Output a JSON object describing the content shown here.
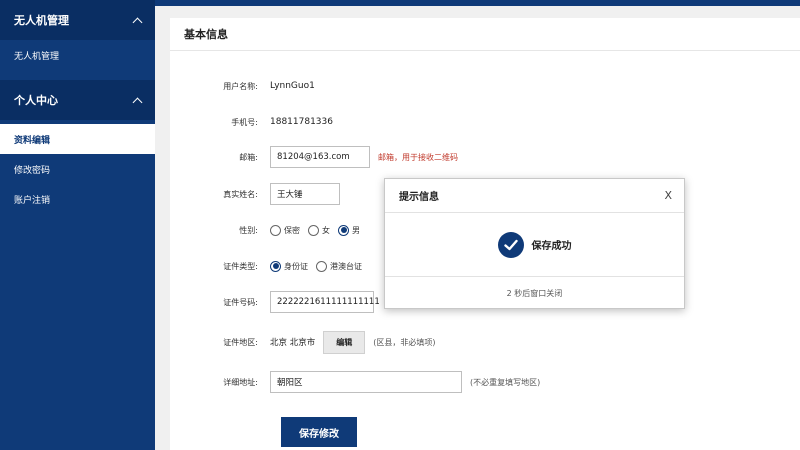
{
  "sidebar": {
    "groups": [
      {
        "title": "无人机管理",
        "items": [
          "无人机管理"
        ]
      },
      {
        "title": "个人中心",
        "items": [
          "资料编辑",
          "修改密码",
          "账户注销"
        ]
      }
    ]
  },
  "panel": {
    "title": "基本信息",
    "fields": {
      "username": {
        "label": "用户名称:",
        "value": "LynnGuo1"
      },
      "phone": {
        "label": "手机号:",
        "value": "18811781336"
      },
      "email": {
        "label": "邮箱:",
        "value": "81204@163.com",
        "hint": "邮箱，用于接收二维码"
      },
      "realname": {
        "label": "真实姓名:",
        "value": "王大锤"
      },
      "gender": {
        "label": "性别:",
        "options": [
          "保密",
          "女",
          "男"
        ],
        "selected": "男"
      },
      "idtype": {
        "label": "证件类型:",
        "options": [
          "身份证",
          "港澳台证"
        ],
        "selected": "身份证"
      },
      "idnumber": {
        "label": "证件号码:",
        "value": "2222221611111111111"
      },
      "idregion": {
        "label": "证件地区:",
        "value": "北京 北京市",
        "button": "编辑",
        "hint": "(区县，非必填项)"
      },
      "address": {
        "label": "详细地址:",
        "value": "朝阳区",
        "hint": "(不必重复填写地区)"
      }
    },
    "save_label": "保存修改"
  },
  "dialog": {
    "title": "提示信息",
    "close": "X",
    "message": "保存成功",
    "footer": "2 秒后窗口关闭"
  },
  "colors": {
    "primary": "#0f3a78",
    "sidebar_header": "#0a2e63",
    "warning": "#c0392b"
  }
}
